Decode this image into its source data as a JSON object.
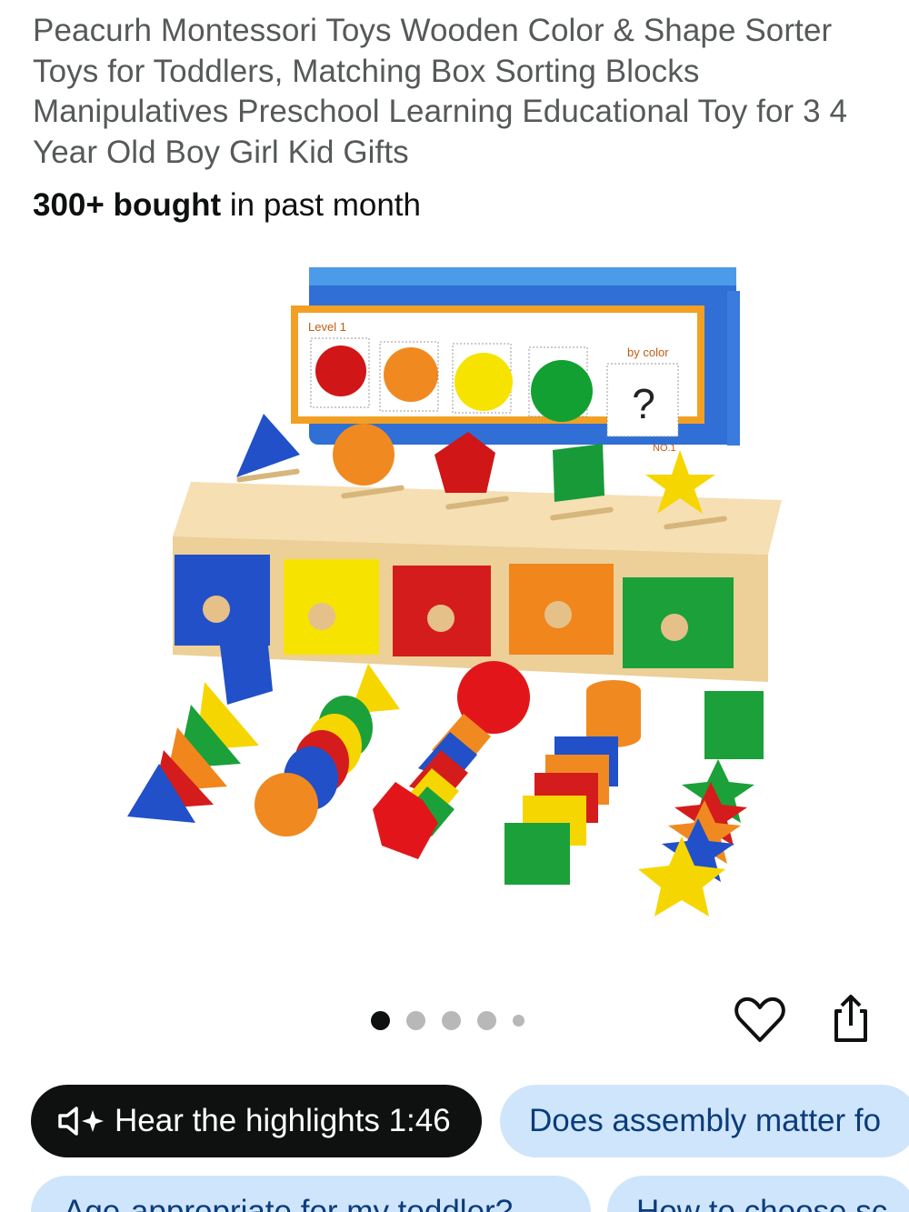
{
  "product": {
    "title": "Peacurh Montessori Toys Wooden Color & Shape Sorter Toys for Toddlers, Matching Box Sorting Blocks Manipulatives Preschool Learning Educational Toy for 3 4 Year Old Boy Girl Kid Gifts",
    "bought_count": "300+ bought",
    "bought_suffix": " in past month"
  },
  "image": {
    "card_level": "Level 1",
    "card_mode": "by color",
    "card_question": "?",
    "card_number": "NO.1"
  },
  "carousel": {
    "total": 5,
    "active_index": 1
  },
  "actions": {
    "favorite_icon": "heart-icon",
    "share_icon": "share-icon"
  },
  "chips": {
    "hear_highlights": "Hear the highlights 1:46",
    "hear_icon": "speaker-sparkle-icon",
    "q1": "Does assembly matter fo",
    "q2": "Age-appropriate for my toddler?",
    "q3": "How to choose sc"
  },
  "colors": {
    "title_text": "#565959",
    "chip_dark": "#0f1111",
    "chip_blue": "#cfe5fb",
    "chip_blue_text": "#0b3c7a"
  }
}
